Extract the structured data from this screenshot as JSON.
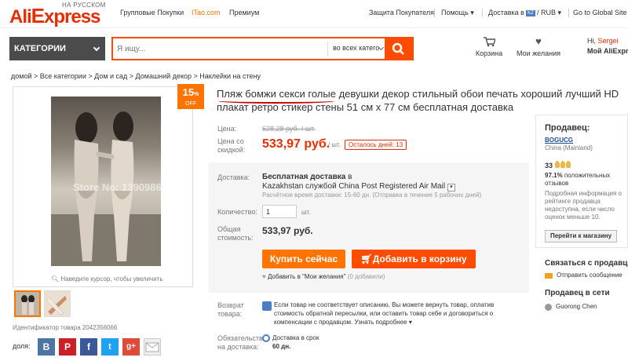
{
  "topbar": {
    "logo_sub": "НА РУССКОМ",
    "logo_a": "Ali",
    "logo_b": "xpress",
    "links": [
      "Групповые Покупки",
      "ITao.com",
      "Премиум"
    ],
    "protection": "Защита Покупателя",
    "help": "Помощь",
    "delivery_label": "Доставка в",
    "flag": "KZ",
    "currency": "/ RUB",
    "global": "Go to Global Site (E"
  },
  "header": {
    "categories_label": "КАТЕГОРИИ",
    "search_placeholder": "Я ищу...",
    "search_category": "во всех катего",
    "cart_label": "Корзина",
    "wishlist_label": "Мои желания",
    "greeting": "Hi,",
    "username": "Sergei",
    "account_label": "Мой AliExpress"
  },
  "breadcrumb": "домой > Все категории > Дом и сад > Домашний декор > Наклейки на стену",
  "gallery": {
    "watermark": "Store No: 1390986",
    "zoom_hint": "Наведите курсор, чтобы увеличить",
    "product_id": "Идентификатор товара 2042356066",
    "share_label": "доля:"
  },
  "badge": {
    "value": "15",
    "unit": "%",
    "off": "OFF"
  },
  "product": {
    "title_highlight": "Пляж бомжи секси голые",
    "title_rest": " девушки декор стильный обои печать хороший лучший HD плакат ретро стикер стены 51 см x 77 см бесплатная доставка"
  },
  "price": {
    "label_price": "Цена:",
    "old_price": "628,28 руб. / шт.",
    "label_discount_1": "Цена со",
    "label_discount_2": "скидкой:",
    "price": "533,97 руб.",
    "unit": "/ шт.",
    "days_left": "Осталось дней: 13"
  },
  "shipping": {
    "label": "Доставка:",
    "free": "Бесплатная доставка",
    "in": " в",
    "service": "Kazakhstan службой China Post Registered Air Mail",
    "estimate": "Расчётное время доставки: 15-60 дн. (Отправка в течение 5 рабочих дней)",
    "qty_label": "Количество:",
    "qty_value": "1",
    "qty_unit": "шт.",
    "total_label_1": "Общая",
    "total_label_2": "стоимость:",
    "total": "533,97 руб.",
    "buy_now": "Купить сейчас",
    "add_to_cart": "Добавить в корзину",
    "wish_text": "Добавить в \"Мои желания\"",
    "wish_count": "(0 добавили)"
  },
  "returns": {
    "label_1": "Возврат",
    "label_2": "товара:",
    "text": "Если товар не соответствует описанию, Вы можете вернуть товар, оплатив стоимость обратной пересылки, или оставить товар себе и договориться о компенсации с продавцом.",
    "more": "Узнать подробнее"
  },
  "delivery_guarantee": {
    "label_1": "Обязательств",
    "label_2": "на доставка:",
    "line1": "Доставка в срок",
    "line2": "60 дн."
  },
  "seller": {
    "heading": "Продавец:",
    "name": "BOGUCG",
    "country": "China (Mainland)",
    "score": "33",
    "feedback_pct": "97.1%",
    "feedback_text": "положительных",
    "feedback_text2": "отзывов",
    "info": [
      "Подробная информация о",
      "рейтинге продавца",
      "недоступна, если число",
      "оценок меньше 10."
    ],
    "shop_button": "Перейти к магазину",
    "contact_heading": "Связаться с продавцом",
    "send_message": "Отправить сообщение",
    "network_heading": "Продавец в сети",
    "contact_name": "Guorong Chen"
  }
}
